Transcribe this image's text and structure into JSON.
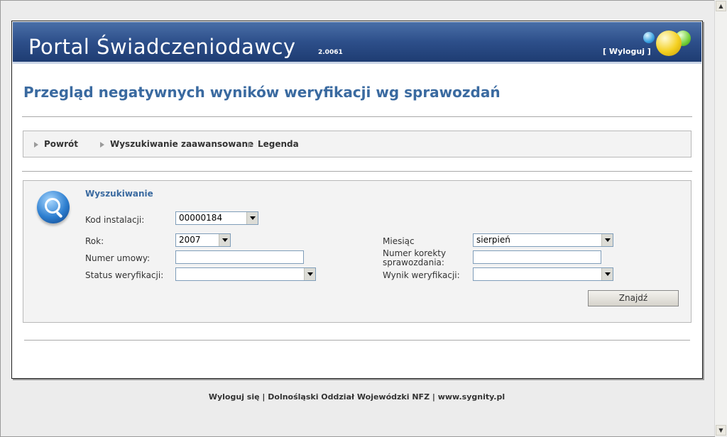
{
  "header": {
    "title": "Portal Świadczeniodawcy",
    "version": "2.0061",
    "logout_label": "[ Wyloguj ]"
  },
  "page": {
    "title": "Przegląd negatywnych wyników weryfikacji wg sprawozdań"
  },
  "nav": {
    "items": [
      {
        "label": "Powrót"
      },
      {
        "label": "Wyszukiwanie zaawansowane"
      },
      {
        "label": "Legenda"
      }
    ]
  },
  "search": {
    "heading": "Wyszukiwanie",
    "fields": {
      "kod_instalacji": {
        "label": "Kod instalacji:",
        "value": "00000184"
      },
      "rok": {
        "label": "Rok:",
        "value": "2007"
      },
      "miesiac": {
        "label": "Miesiąc",
        "value": "sierpień"
      },
      "numer_umowy": {
        "label": "Numer umowy:",
        "value": ""
      },
      "numer_korekty": {
        "label": "Numer korekty sprawozdania:",
        "value": ""
      },
      "status_weryfikacji": {
        "label": "Status weryfikacji:",
        "value": ""
      },
      "wynik_weryfikacji": {
        "label": "Wynik weryfikacji:",
        "value": ""
      }
    },
    "find_label": "Znajdź"
  },
  "footer": {
    "text": "Wyloguj się | Dolnośląski Oddział Wojewódzki NFZ | www.sygnity.pl"
  },
  "colors": {
    "header_bg": "#2d4f8a",
    "title_blue": "#3a6aa0",
    "panel_bg": "#f3f3f3"
  },
  "icons": {
    "search": "magnifier-icon",
    "nav_bullet": "triangle-right-icon",
    "dropdown": "chevron-down-icon"
  }
}
